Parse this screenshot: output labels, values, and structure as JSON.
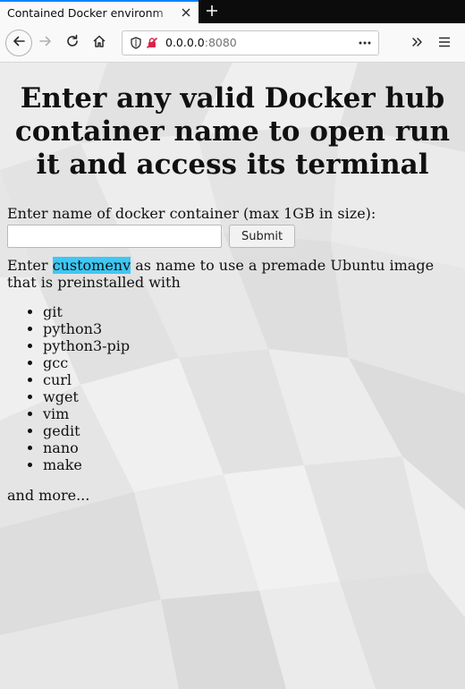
{
  "browser": {
    "tab_title": "Contained Docker environm",
    "url_host": "0.0.0.0",
    "url_port": ":8080"
  },
  "page": {
    "heading": "Enter any valid Docker hub container name to open run it and access its terminal",
    "input_label": "Enter name of docker container (max 1GB in size):",
    "input_value": "",
    "submit_label": "Submit",
    "desc_before": "Enter ",
    "desc_highlight": "customenv",
    "desc_after": " as name to use a premade Ubuntu image that is preinstalled with",
    "packages": [
      "git",
      "python3",
      "python3-pip",
      "gcc",
      "curl",
      "wget",
      "vim",
      "gedit",
      "nano",
      "make"
    ],
    "more_text": "and more..."
  },
  "colors": {
    "highlight": "#3ec7f4",
    "tab_accent": "#0a84ff"
  },
  "icons": [
    "close-icon",
    "plus-icon",
    "back-arrow-icon",
    "forward-arrow-icon",
    "reload-icon",
    "home-icon",
    "shield-icon",
    "insecure-lock-icon",
    "more-actions-icon",
    "overflow-chevron-icon",
    "menu-icon"
  ]
}
